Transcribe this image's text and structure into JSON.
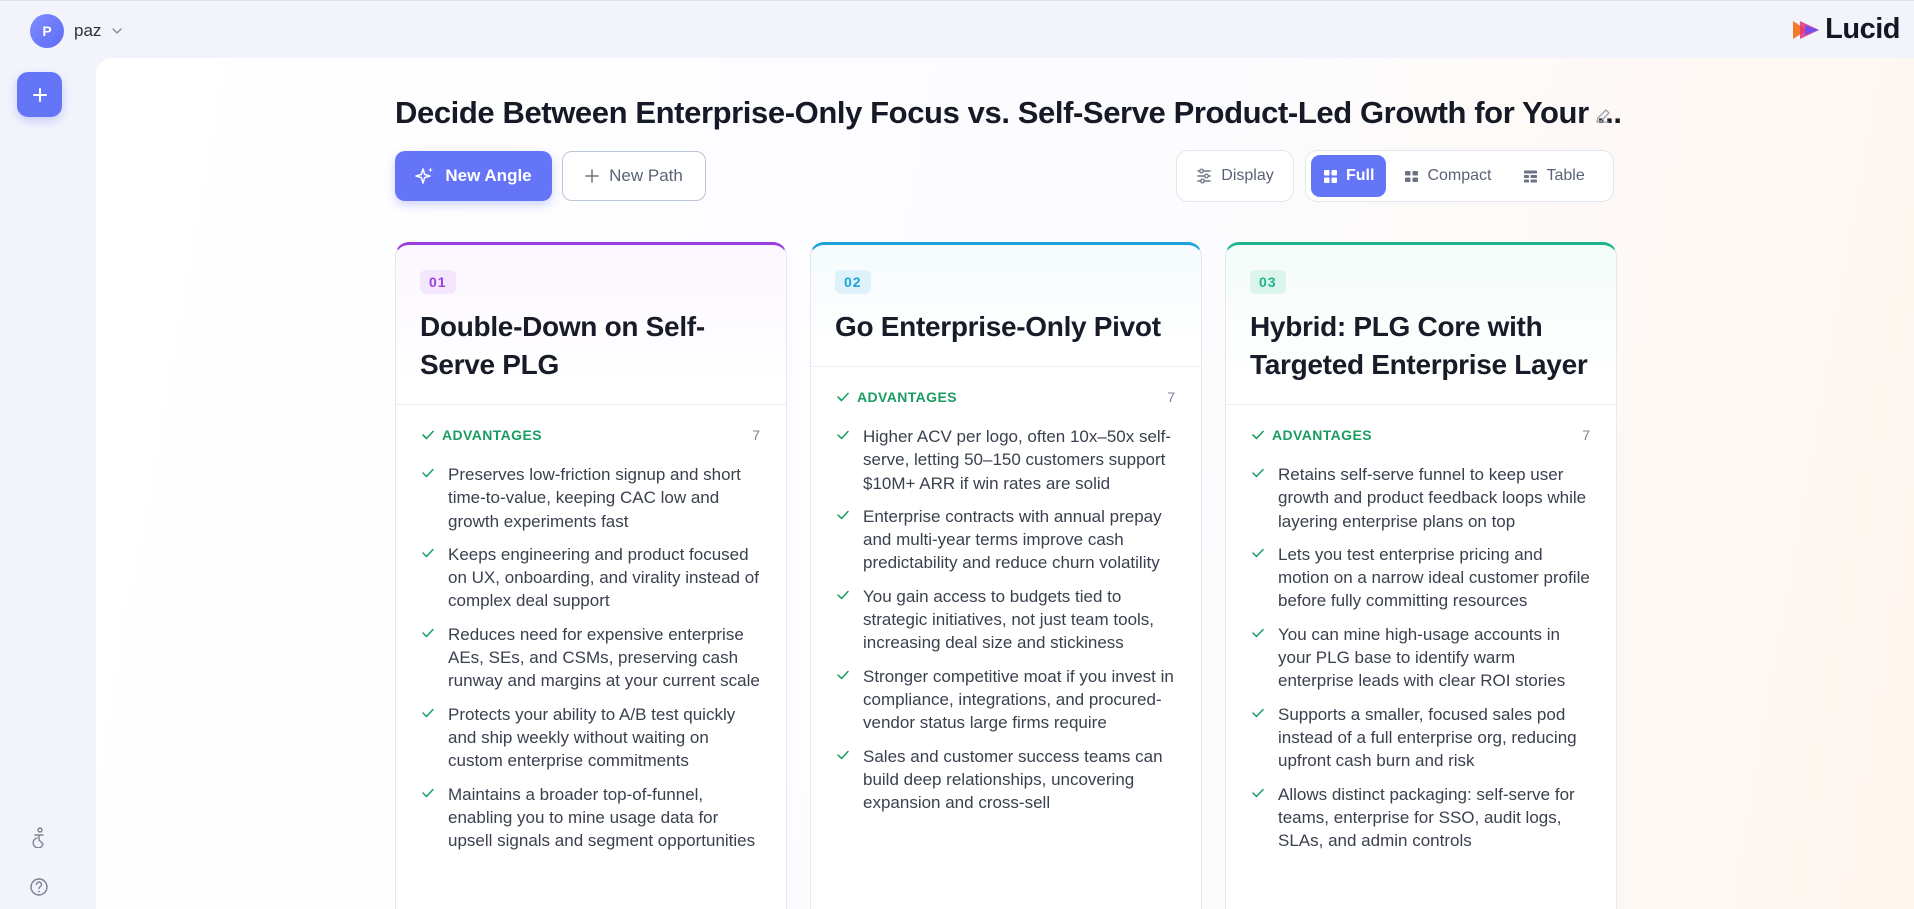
{
  "user": {
    "initial": "P",
    "name": "paz"
  },
  "brand": {
    "name": "Lucid"
  },
  "page": {
    "title": "Decide Between Enterprise-Only Focus vs. Self-Serve Product-Led Growth for Your ..."
  },
  "toolbar": {
    "new_angle": "New Angle",
    "new_path": "New Path",
    "display": "Display",
    "views": {
      "full": "Full",
      "compact": "Compact",
      "table": "Table"
    },
    "active_view": "Full"
  },
  "cards": [
    {
      "number": "01",
      "title": "Double-Down on Self-Serve PLG",
      "accent": "#9b3fe0",
      "badge_bg": "#f3e6fd",
      "advantages_label": "ADVANTAGES",
      "advantages_count": "7",
      "items": [
        "Preserves low-friction signup and short time-to-value, keeping CAC low and growth experiments fast",
        "Keeps engineering and product focused on UX, onboarding, and virality instead of complex deal support",
        "Reduces need for expensive enterprise AEs, SEs, and CSMs, preserving cash runway and margins at your current scale",
        "Protects your ability to A/B test quickly and ship weekly without waiting on custom enterprise commitments",
        "Maintains a broader top-of-funnel, enabling you to mine usage data for upsell signals and segment opportunities"
      ]
    },
    {
      "number": "02",
      "title": "Go Enterprise-Only Pivot",
      "accent": "#1aa3d6",
      "badge_bg": "#dff2fb",
      "advantages_label": "ADVANTAGES",
      "advantages_count": "7",
      "items": [
        "Higher ACV per logo, often 10x–50x self-serve, letting 50–150 customers support $10M+ ARR if win rates are solid",
        "Enterprise contracts with annual prepay and multi-year terms improve cash predictability and reduce churn volatility",
        "You gain access to budgets tied to strategic initiatives, not just team tools, increasing deal size and stickiness",
        "Stronger competitive moat if you invest in compliance, integrations, and procured-vendor status large firms require",
        "Sales and customer success teams can build deep relationships, uncovering expansion and cross-sell"
      ]
    },
    {
      "number": "03",
      "title": "Hybrid: PLG Core with Targeted Enterprise Layer",
      "accent": "#1db58e",
      "badge_bg": "#dcf5ec",
      "advantages_label": "ADVANTAGES",
      "advantages_count": "7",
      "items": [
        "Retains self-serve funnel to keep user growth and product feedback loops while layering enterprise plans on top",
        "Lets you test enterprise pricing and motion on a narrow ideal customer profile before fully committing resources",
        "You can mine high-usage accounts in your PLG base to identify warm enterprise leads with clear ROI stories",
        "Supports a smaller, focused sales pod instead of a full enterprise org, reducing upfront cash burn and risk",
        "Allows distinct packaging: self-serve for teams, enterprise for SSO, audit logs, SLAs, and admin controls"
      ]
    }
  ],
  "icons": {
    "add": "plus-icon",
    "accessibility": "accessibility-icon",
    "help": "help-icon",
    "edit": "pencil-icon",
    "sparkles": "sparkles-icon",
    "check": "check-icon"
  }
}
